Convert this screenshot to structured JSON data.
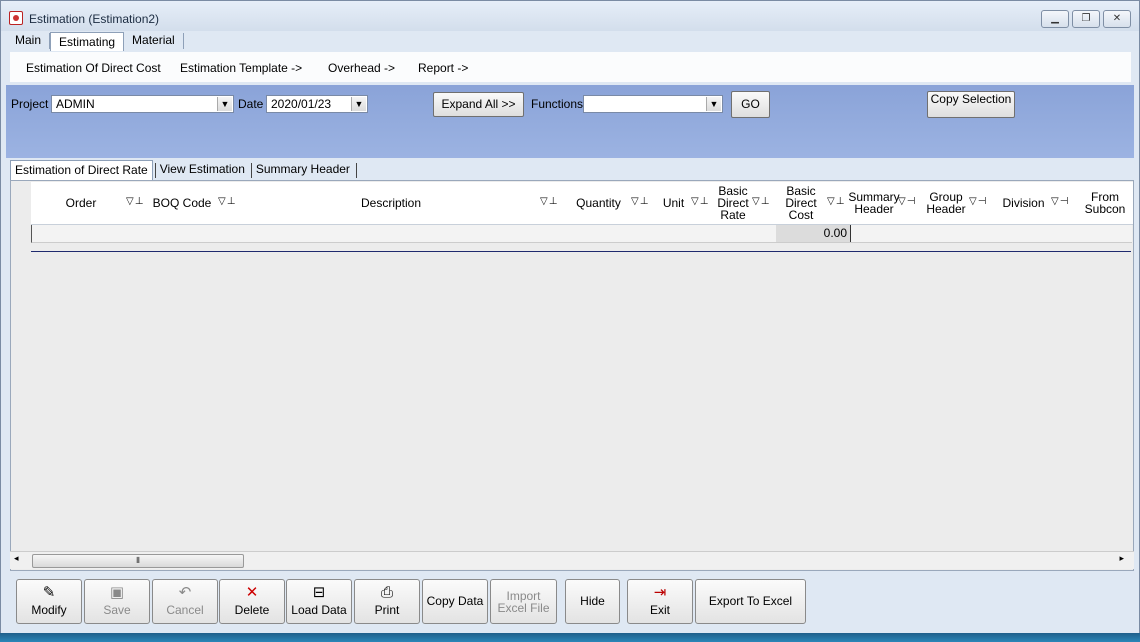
{
  "window": {
    "title": "Estimation  (Estimation2)"
  },
  "menu_tabs": [
    "Main",
    "Estimating",
    "Material"
  ],
  "submenu": [
    "Estimation Of Direct Cost",
    "Estimation Template  ->",
    "Overhead  ->",
    "Report  ->"
  ],
  "toolbar": {
    "project_label": "Project",
    "project_value": "ADMIN",
    "date_label": "Date",
    "date_value": "2020/01/23",
    "expand_all": "Expand All >>",
    "functions_label": "Functions",
    "functions_value": "",
    "go": "GO",
    "copy_selection": "Copy Selection"
  },
  "view_tabs": [
    "Estimation of Direct Rate",
    "View Estimation",
    "Summary Header"
  ],
  "columns": [
    "Order",
    "BOQ Code",
    "Description",
    "Quantity",
    "Unit",
    "Basic Direct Rate",
    "Basic Direct Cost",
    "Summary Header",
    "Group Header",
    "Division",
    "From Subcon"
  ],
  "grid": {
    "total_cost": "0.00"
  },
  "bottom_buttons": [
    {
      "label": "Modify",
      "icon": "pencil-icon",
      "enabled": true
    },
    {
      "label": "Save",
      "icon": "floppy-icon",
      "enabled": false
    },
    {
      "label": "Cancel",
      "icon": "undo-icon",
      "enabled": false
    },
    {
      "label": "Delete",
      "icon": "x-icon",
      "enabled": true
    },
    {
      "label": "Load Data",
      "icon": "load-icon",
      "enabled": true
    },
    {
      "label": "Print",
      "icon": "printer-icon",
      "enabled": true
    },
    {
      "label": "Copy Data",
      "icon": "",
      "enabled": true
    },
    {
      "label": "Import Excel File",
      "icon": "",
      "enabled": false
    },
    {
      "label": "Hide",
      "icon": "",
      "enabled": true
    },
    {
      "label": "Exit",
      "icon": "exit-door-icon",
      "enabled": true
    },
    {
      "label": "Export To Excel",
      "icon": "",
      "enabled": true
    }
  ]
}
